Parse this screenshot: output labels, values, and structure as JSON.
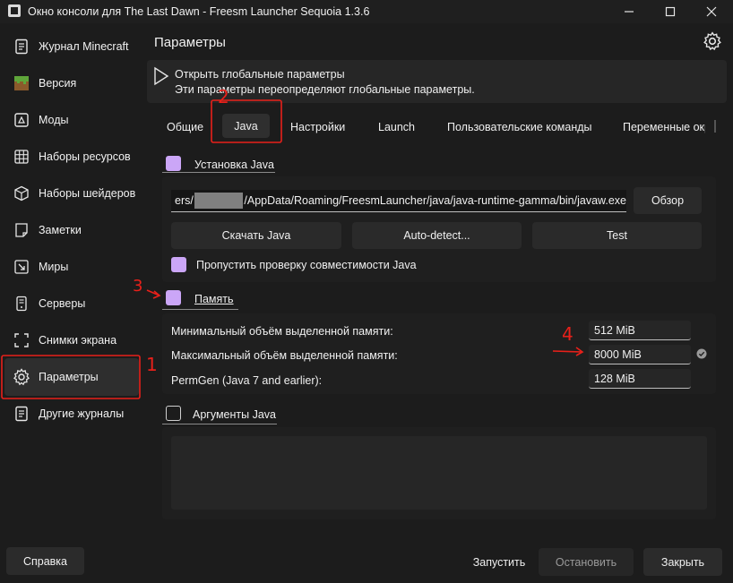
{
  "window": {
    "title": "Окно консоли для The Last Dawn - Freesm Launcher Sequoia 1.3.6",
    "minimize_icon": "minimize-icon",
    "maximize_icon": "maximize-icon",
    "close_icon": "close-icon"
  },
  "sidebar": {
    "items": [
      {
        "label": "Журнал Minecraft",
        "icon": "log-icon"
      },
      {
        "label": "Версия",
        "icon": "grass-block-icon"
      },
      {
        "label": "Моды",
        "icon": "mod-icon"
      },
      {
        "label": "Наборы ресурсов",
        "icon": "grid-icon"
      },
      {
        "label": "Наборы шейдеров",
        "icon": "cube-icon"
      },
      {
        "label": "Заметки",
        "icon": "note-icon"
      },
      {
        "label": "Миры",
        "icon": "world-icon"
      },
      {
        "label": "Серверы",
        "icon": "server-icon"
      },
      {
        "label": "Снимки экрана",
        "icon": "screenshot-icon"
      },
      {
        "label": "Параметры",
        "icon": "gear-icon",
        "active": true
      },
      {
        "label": "Другие журналы",
        "icon": "log-icon"
      }
    ],
    "help_label": "Справка"
  },
  "main": {
    "title": "Параметры",
    "banner": {
      "line1": "Открыть глобальные параметры",
      "line2": "Эти параметры переопределяют глобальные параметры."
    },
    "tabs": [
      "Общие",
      "Java",
      "Настройки",
      "Launch",
      "Пользовательские команды",
      "Переменные окр"
    ],
    "selected_tab": "Java",
    "java_install": {
      "title": "Установка Java",
      "path_prefix": "ers/",
      "path_suffix": "/AppData/Roaming/FreesmLauncher/java/java-runtime-gamma/bin/javaw.exe",
      "browse_label": "Обзор",
      "download_label": "Скачать Java",
      "autodetect_label": "Auto-detect...",
      "test_label": "Test",
      "skip_check_label": "Пропустить проверку совместимости Java"
    },
    "memory": {
      "title": "Память",
      "min_label": "Минимальный объём выделенной памяти:",
      "min_value": "512 MiB",
      "max_label": "Максимальный объём выделенной памяти:",
      "max_value": "8000 MiB",
      "permgen_label": "PermGen (Java 7 and earlier):",
      "permgen_value": "128 MiB"
    },
    "java_args": {
      "title": "Аргументы Java"
    }
  },
  "footer": {
    "launch_label": "Запустить",
    "stop_label": "Остановить",
    "close_label": "Закрыть"
  },
  "annotations": {
    "a1": "1",
    "a2": "2",
    "a3": "3",
    "a4": "4"
  },
  "colors": {
    "accent_check": "#cba6f7",
    "annotation_red": "#e8201a",
    "background": "#1c1c1c"
  }
}
